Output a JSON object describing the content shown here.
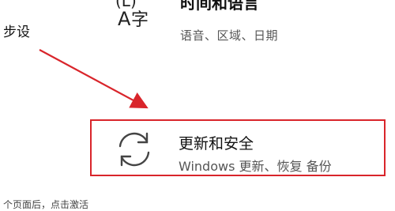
{
  "left_note": "步设",
  "time_language_tile": {
    "title": "时间和语言",
    "subtitle": "语音、区域、日期",
    "icon": "time-language-icon"
  },
  "update_security_tile": {
    "title": "更新和安全",
    "subtitle": "Windows 更新、恢复  备份",
    "icon": "sync-arrows-icon"
  },
  "bottom_note": "个页面后，点击激活",
  "colors": {
    "highlight": "#d9252b",
    "title_text": "#111111",
    "subtitle_text": "#555555"
  }
}
